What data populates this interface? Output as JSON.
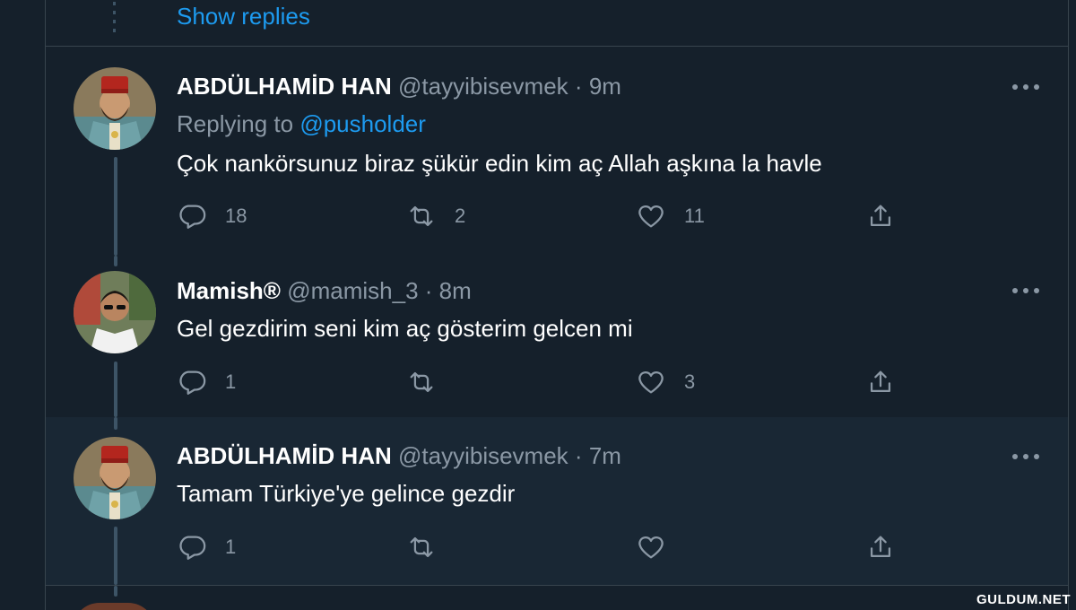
{
  "top": {
    "show_replies": "Show replies"
  },
  "tweets": [
    {
      "name": "ABDÜLHAMİD HAN",
      "handle": "@tayyibisevmek",
      "sep": "·",
      "time": "9m",
      "replying_prefix": "Replying to",
      "replying_to": "@pusholder",
      "text": "Çok nankörsunuz biraz şükür edin kim aç Allah aşkına la havle",
      "reply_count": "18",
      "retweet_count": "2",
      "like_count": "11"
    },
    {
      "name": "Mamish®",
      "handle": "@mamish_3",
      "sep": "·",
      "time": "8m",
      "text": "Gel gezdirim seni kim aç gösterim gelcen mi",
      "reply_count": "1",
      "retweet_count": "",
      "like_count": "3"
    },
    {
      "name": "ABDÜLHAMİD HAN",
      "handle": "@tayyibisevmek",
      "sep": "·",
      "time": "7m",
      "text": "Tamam Türkiye'ye gelince gezdir",
      "reply_count": "1",
      "retweet_count": "",
      "like_count": ""
    }
  ],
  "icons": {
    "reply": "reply-icon",
    "retweet": "retweet-icon",
    "like": "heart-icon",
    "share": "share-icon",
    "more": "more-icon"
  },
  "watermark": "GULDUM.NET",
  "colors": {
    "background": "#15202b",
    "highlight": "#192734",
    "accent": "#1d9bf0",
    "muted": "#8b98a5",
    "border": "#38444d"
  }
}
